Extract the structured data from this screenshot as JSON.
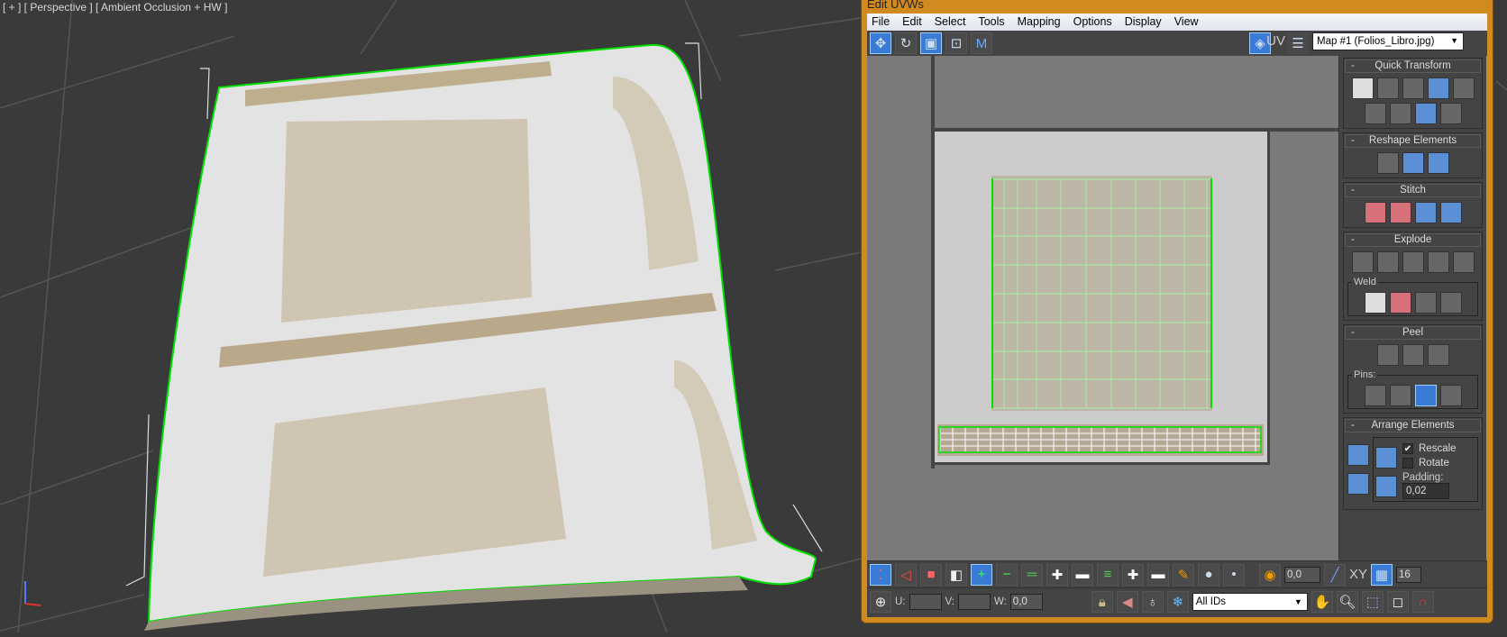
{
  "viewport": {
    "label": "[ + ] [ Perspective ] [ Ambient Occlusion + HW ]"
  },
  "window": {
    "title": "Edit UVWs",
    "menu": [
      "File",
      "Edit",
      "Select",
      "Tools",
      "Mapping",
      "Options",
      "Display",
      "View"
    ],
    "toolbar": {
      "uv_label": "UV",
      "map_select": "Map #1 (Folios_Libro.jpg)"
    }
  },
  "panel": {
    "quick_transform": "Quick Transform",
    "reshape": "Reshape Elements",
    "stitch": "Stitch",
    "explode": "Explode",
    "weld": "Weld",
    "peel": "Peel",
    "pins": "Pins:",
    "arrange": "Arrange Elements",
    "rescale": "Rescale",
    "rescale_checked": true,
    "rotate": "Rotate",
    "rotate_checked": false,
    "padding_label": "Padding:",
    "padding": "0,02",
    "collapse": "-"
  },
  "bottom": {
    "soft_value": "0,0",
    "grid_value": "16",
    "xy_label": "XY",
    "u_label": "U:",
    "v_label": "V:",
    "w_label": "W:",
    "u_value": "",
    "v_value": "",
    "w_value": "0,0",
    "ids": "All IDs"
  },
  "colors": {
    "accent": "#3a7bd5",
    "frame": "#d08a20",
    "seam": "#00ff00"
  }
}
